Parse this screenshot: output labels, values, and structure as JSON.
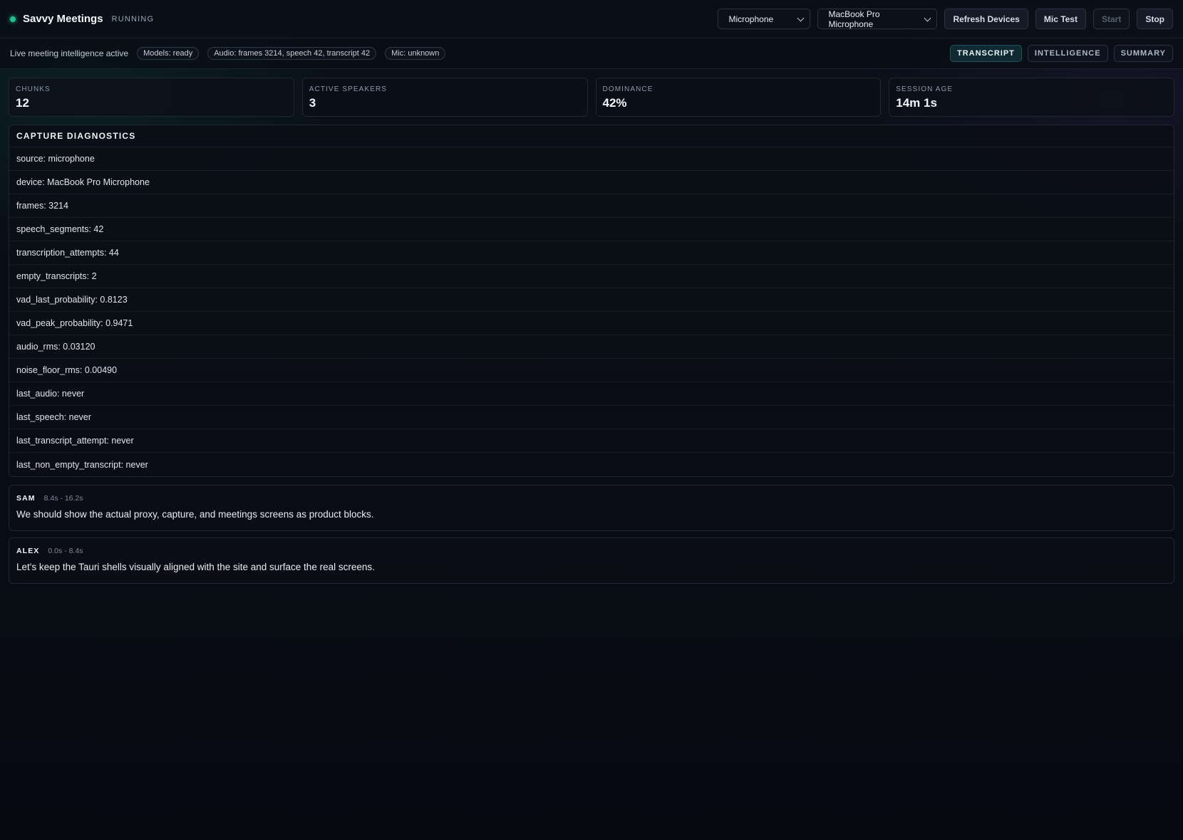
{
  "header": {
    "app_title": "Savvy Meetings",
    "state": "RUNNING",
    "source_select": "Microphone",
    "device_select": "MacBook Pro Microphone",
    "buttons": {
      "refresh": "Refresh Devices",
      "mic_test": "Mic Test",
      "start": "Start",
      "stop": "Stop"
    }
  },
  "statusbar": {
    "live_text": "Live meeting intelligence active",
    "pills": {
      "models": "Models: ready",
      "audio": "Audio: frames 3214, speech 42, transcript 42",
      "mic": "Mic: unknown"
    },
    "tabs": {
      "transcript": "TRANSCRIPT",
      "intelligence": "INTELLIGENCE",
      "summary": "SUMMARY"
    },
    "active_tab": "transcript"
  },
  "stats": [
    {
      "label": "CHUNKS",
      "value": "12"
    },
    {
      "label": "ACTIVE SPEAKERS",
      "value": "3"
    },
    {
      "label": "DOMINANCE",
      "value": "42%"
    },
    {
      "label": "SESSION AGE",
      "value": "14m 1s"
    }
  ],
  "diagnostics": {
    "title": "CAPTURE DIAGNOSTICS",
    "rows": [
      "source: microphone",
      "device: MacBook Pro Microphone",
      "frames: 3214",
      "speech_segments: 42",
      "transcription_attempts: 44",
      "empty_transcripts: 2",
      "vad_last_probability: 0.8123",
      "vad_peak_probability: 0.9471",
      "audio_rms: 0.03120",
      "noise_floor_rms: 0.00490",
      "last_audio: never",
      "last_speech: never",
      "last_transcript_attempt: never",
      "last_non_empty_transcript: never"
    ]
  },
  "transcript": [
    {
      "speaker": "SAM",
      "time": "8.4s - 16.2s",
      "text": "We should show the actual proxy, capture, and meetings screens as product blocks."
    },
    {
      "speaker": "ALEX",
      "time": "0.0s - 8.4s",
      "text": "Let's keep the Tauri shells visually aligned with the site and surface the real screens."
    }
  ],
  "colors": {
    "accent_running": "#22c08d",
    "background": "#070b12",
    "active_tab_bg": "#0f2a33"
  }
}
